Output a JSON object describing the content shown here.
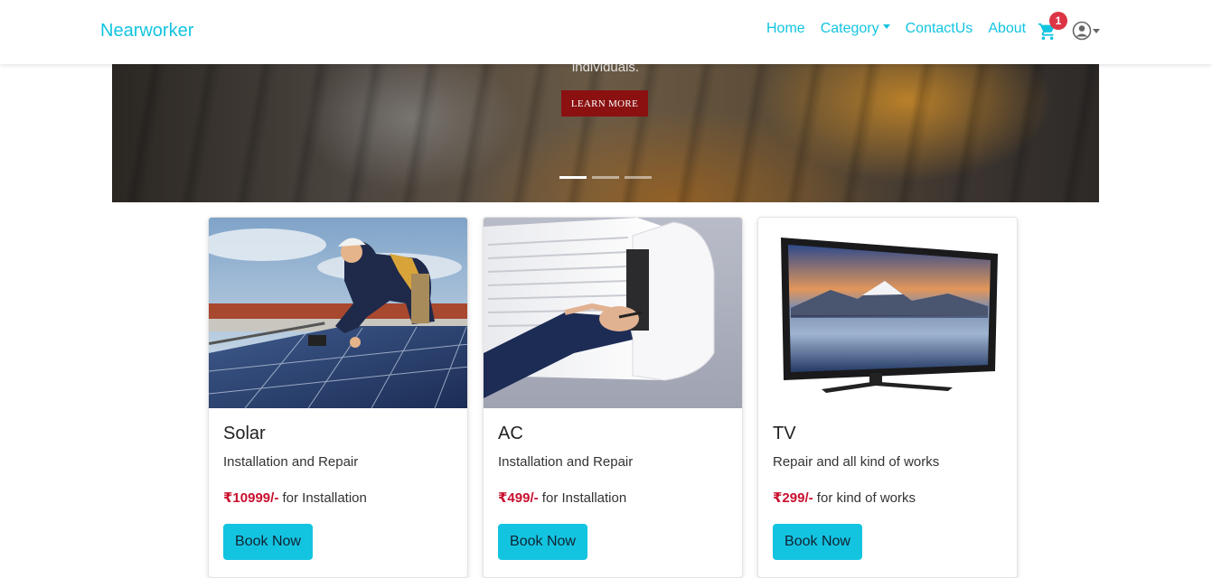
{
  "navbar": {
    "brand": "Nearworker",
    "links": [
      {
        "label": "Home"
      },
      {
        "label": "Category"
      },
      {
        "label": "ContactUs"
      },
      {
        "label": "About"
      }
    ],
    "cart_count": "1",
    "accent_color": "#13c4e0"
  },
  "carousel": {
    "caption": "individuals.",
    "button_label": "LEARN MORE",
    "slide_count": 3,
    "active_slide": 1
  },
  "cards": [
    {
      "title": "Solar",
      "subtitle": "Installation and Repair",
      "price": "₹10999/-",
      "price_note": " for Installation",
      "button": "Book Now"
    },
    {
      "title": "AC",
      "subtitle": "Installation and Repair",
      "price": "₹499/-",
      "price_note": " for Installation",
      "button": "Book Now"
    },
    {
      "title": "TV",
      "subtitle": "Repair and all kind of works",
      "price": "₹299/-",
      "price_note": " for kind of works",
      "button": "Book Now"
    }
  ]
}
